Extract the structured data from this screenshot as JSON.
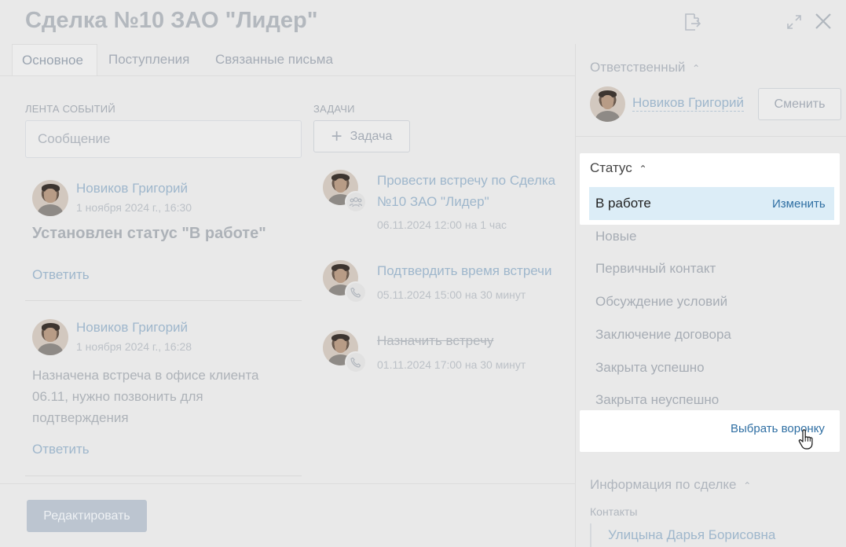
{
  "header": {
    "title": "Сделка №10 ЗАО \"Лидер\""
  },
  "tabs": [
    {
      "label": "Основное"
    },
    {
      "label": "Поступления"
    },
    {
      "label": "Связанные письма"
    }
  ],
  "feed": {
    "label": "ЛЕНТА СОБЫТИЙ",
    "message_placeholder": "Сообщение",
    "items": [
      {
        "author": "Новиков Григорий",
        "date": "1 ноября 2024 г., 16:30",
        "text": "Установлен статус \"В работе\"",
        "reply": "Ответить"
      },
      {
        "author": "Новиков Григорий",
        "date": "1 ноября 2024 г., 16:28",
        "text": "Назначена встреча в офисе клиента 06.11, нужно позвонить для подтверждения",
        "reply": "Ответить"
      }
    ]
  },
  "tasks": {
    "label": "ЗАДАЧИ",
    "add_label": "Задача",
    "items": [
      {
        "title": "Провести встречу по Сделка №10 ЗАО \"Лидер\"",
        "meta_time": "06.11.2024 12:00",
        "meta_duration": "на 1 час",
        "icon": "group-icon"
      },
      {
        "title": "Подтвердить время встречи",
        "meta_time": "05.11.2024 15:00",
        "meta_duration": "на 30 минут",
        "icon": "phone-icon"
      },
      {
        "title": "Назначить встречу",
        "meta_time": "01.11.2024 17:00",
        "meta_duration": "на 30 минут",
        "icon": "phone-icon",
        "strikethrough": true
      }
    ]
  },
  "responsible": {
    "label": "Ответственный",
    "name": "Новиков Григорий",
    "change_label": "Сменить"
  },
  "status": {
    "label": "Статус",
    "current": "В работе",
    "change_label": "Изменить",
    "options": [
      "Новые",
      "Первичный контакт",
      "Обсуждение условий",
      "Заключение договора",
      "Закрыта успешно",
      "Закрыта неуспешно"
    ],
    "funnel_link": "Выбрать воронку"
  },
  "deal_info": {
    "label": "Информация по сделке",
    "contacts_label": "Контакты",
    "contact_name": "Улицына Дарья Борисовна"
  },
  "footer": {
    "edit_label": "Редактировать"
  },
  "colors": {
    "accent": "#2f6fa3",
    "selected_bg": "#dcedf7",
    "overlay_bg": "#e9e9e9"
  }
}
